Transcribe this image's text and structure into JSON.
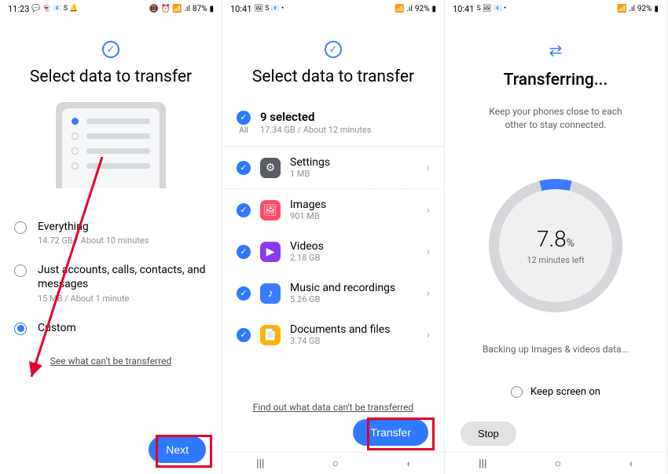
{
  "screen1": {
    "status_time": "11:23",
    "status_icons_left": "💬 👻 📧 S 🔔",
    "status_battery": "87%",
    "status_net": "📵 ⏰ 📶 .ıl",
    "title": "Select data to transfer",
    "options": [
      {
        "title": "Everything",
        "sub": "14.72 GB / About 10 minutes",
        "selected": false
      },
      {
        "title": "Just accounts, calls, contacts, and messages",
        "sub": "15 MB / About 1 minute",
        "selected": false
      },
      {
        "title": "Custom",
        "sub": "",
        "selected": true
      }
    ],
    "link": "See what can't be transferred",
    "button": "Next"
  },
  "screen2": {
    "status_time": "10:41",
    "status_icons_left": "🖼 S 📧 •",
    "status_battery": "92%",
    "status_net": "📶 .ıl",
    "title": "Select data to transfer",
    "all_label": "All",
    "selected_title": "9 selected",
    "selected_sub": "17.34 GB / About 12 minutes",
    "items": [
      {
        "icon": "settings",
        "title": "Settings",
        "sub": "1 MB"
      },
      {
        "icon": "images",
        "title": "Images",
        "sub": "901 MB"
      },
      {
        "icon": "videos",
        "title": "Videos",
        "sub": "2.18 GB"
      },
      {
        "icon": "music",
        "title": "Music and recordings",
        "sub": "5.26 GB"
      },
      {
        "icon": "docs",
        "title": "Documents and files",
        "sub": "3.74 GB"
      }
    ],
    "link": "Find out what data can't be transferred",
    "button": "Transfer"
  },
  "screen3": {
    "status_time": "10:41",
    "status_icons_left": "S 🖼 📧 •",
    "status_battery": "92%",
    "status_net": "📶 .ıl",
    "title": "Transferring...",
    "subtitle": "Keep your phones close to each other to stay connected.",
    "percent": "7.8",
    "percent_unit": "%",
    "eta": "12 minutes left",
    "status_text": "Backing up Images & videos data...",
    "keep_label": "Keep screen on",
    "stop": "Stop"
  }
}
